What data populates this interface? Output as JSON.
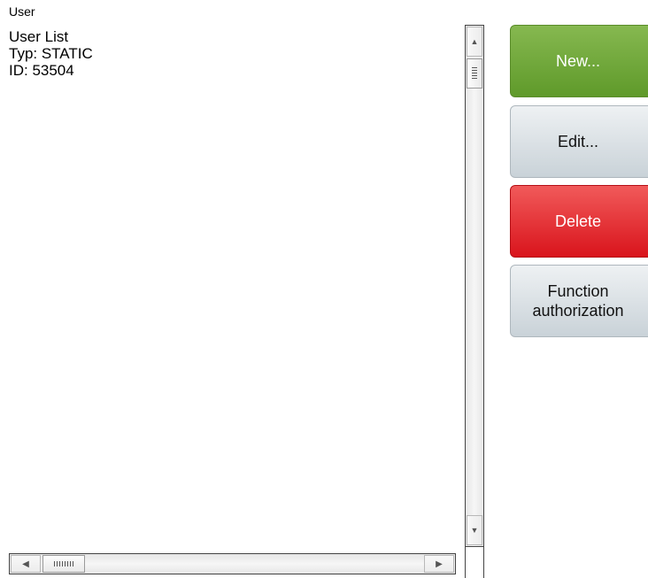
{
  "breadcrumb": "User",
  "details": {
    "title": "User List",
    "type": "Typ: STATIC",
    "id": "ID: 53504"
  },
  "buttons": {
    "new": "New...",
    "edit": "Edit...",
    "delete": "Delete",
    "function_line1": "Function",
    "function_line2": "authorization"
  },
  "icons": {
    "up": "▲",
    "down": "▼",
    "left": "◀",
    "right": "▶"
  },
  "colors": {
    "new": "#6fa83a",
    "delete": "#e2262c",
    "neutral": "#d6dde2"
  }
}
